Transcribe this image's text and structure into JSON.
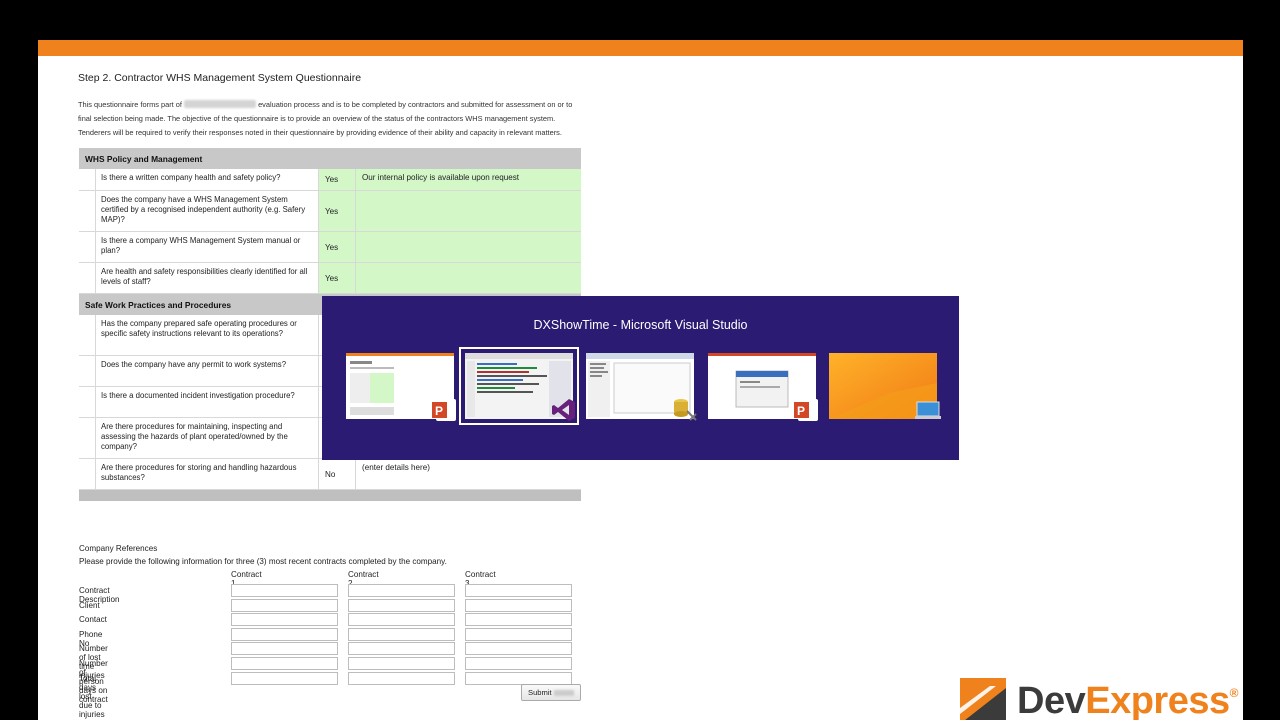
{
  "colors": {
    "orange": "#f0821e",
    "green_cell": "#d4f7c8",
    "section_gray": "#c8c8c8",
    "switcher_bg": "#2b1b72",
    "brand_dark": "#3b3b3b"
  },
  "page": {
    "title": "Step 2. Contractor WHS Management System Questionnaire",
    "intro": {
      "before_blur": "This questionnaire forms part of",
      "after_blur": "evaluation process and is to be completed by contractors and submitted for assessment on or to final selection being made. The objective of the questionnaire is to provide an overview of the status of the contractors WHS management system. Tenderers will be required to verify their responses noted in their questionnaire by providing evidence of their ability and capacity in relevant matters."
    }
  },
  "sections": [
    {
      "heading": "WHS Policy and Management",
      "rows": [
        {
          "q": "Is there a written company health and safety policy?",
          "a": "Yes",
          "c": "Our internal policy is available upon request"
        },
        {
          "q": "Does the company have a WHS Management System certified by a recognised independent authority (e.g. Safery MAP)?",
          "a": "Yes",
          "c": ""
        },
        {
          "q": "Is there a company WHS Management System manual or plan?",
          "a": "Yes",
          "c": ""
        },
        {
          "q": "Are health and safety responsibilities clearly identified for all levels of staff?",
          "a": "Yes",
          "c": ""
        }
      ]
    },
    {
      "heading": "Safe Work Practices and Procedures",
      "rows": [
        {
          "q": "Has the company prepared safe operating procedures or specific safety instructions relevant to its operations?",
          "a": "",
          "c": ""
        },
        {
          "q": "Does the company have any permit to work systems?",
          "a": "",
          "c": ""
        },
        {
          "q": "Is there a documented incident investigation procedure?",
          "a": "",
          "c": ""
        },
        {
          "q": "Are there procedures for maintaining, inspecting and assessing the hazards of plant operated/owned by the company?",
          "a": "",
          "c": ""
        },
        {
          "q": "Are there procedures for storing and handling hazardous substances?",
          "a": "No",
          "c": "(enter details here)"
        }
      ]
    }
  ],
  "references": {
    "title": "Company References",
    "instruction": "Please provide the following information for three (3) most recent contracts completed by the company.",
    "columns": [
      "Contract 1",
      "Contract 2",
      "Contract 3"
    ],
    "rows": [
      "Contract Description",
      "Client",
      "Contact",
      "Phone No",
      "Number of lost time injuries",
      "Number of person days on contract",
      "Total days lost due to injuries"
    ],
    "submit_label": "Submit"
  },
  "switcher": {
    "title": "DXShowTime - Microsoft Visual Studio",
    "windows": [
      {
        "app": "powerpoint-icon",
        "selected": false
      },
      {
        "app": "visual-studio-icon",
        "selected": true
      },
      {
        "app": "database-tools-icon",
        "selected": false
      },
      {
        "app": "powerpoint-icon",
        "selected": false
      },
      {
        "app": "desktop-icon",
        "selected": false
      }
    ]
  },
  "brand": {
    "name_part1": "Dev",
    "name_part2": "Express",
    "mark": "®"
  }
}
